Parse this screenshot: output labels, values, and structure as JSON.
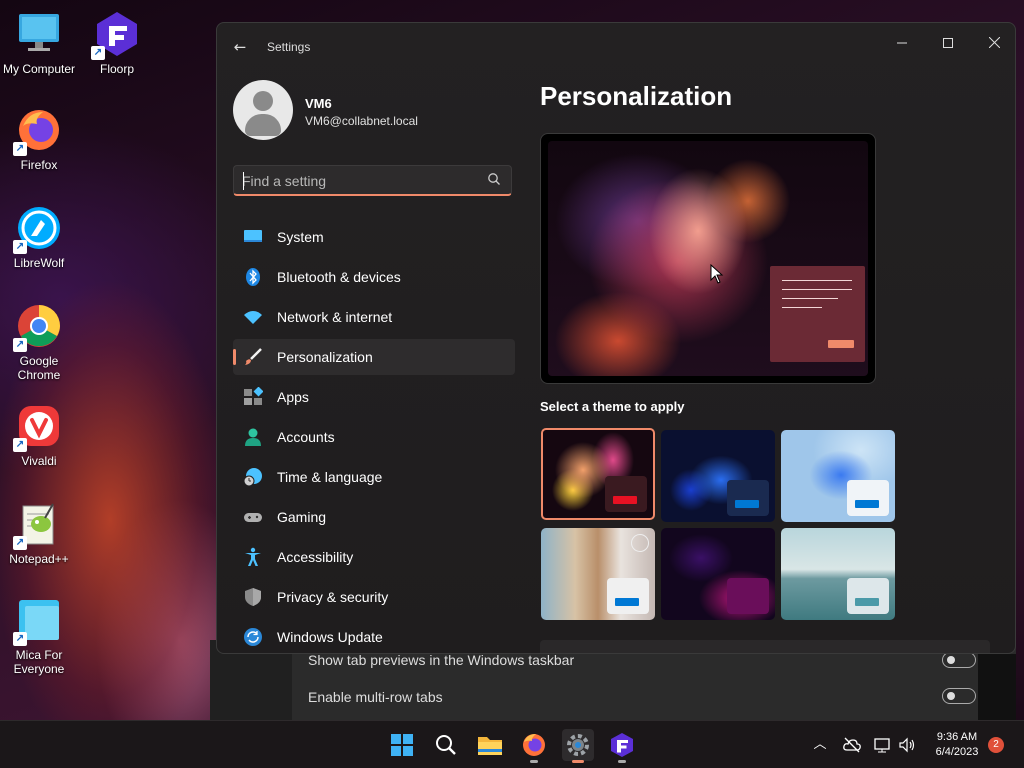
{
  "desktop": {
    "icons": [
      {
        "label": "My Computer",
        "icon": "computer-icon"
      },
      {
        "label": "Floorp",
        "icon": "floorp-icon"
      },
      {
        "label": "Firefox",
        "icon": "firefox-icon"
      },
      {
        "label": "LibreWolf",
        "icon": "librewolf-icon"
      },
      {
        "label": "Google Chrome",
        "icon": "chrome-icon"
      },
      {
        "label": "Vivaldi",
        "icon": "vivaldi-icon"
      },
      {
        "label": "Notepad++",
        "icon": "notepadpp-icon"
      },
      {
        "label": "Mica For Everyone",
        "icon": "mica-icon"
      }
    ]
  },
  "background_app": {
    "rows": [
      {
        "label": "Show tab previews in the Windows taskbar"
      },
      {
        "label": "Enable multi-row tabs"
      }
    ]
  },
  "settings": {
    "title": "Settings",
    "user": {
      "name": "VM6",
      "email": "VM6@collabnet.local"
    },
    "search": {
      "placeholder": "Find a setting"
    },
    "nav": [
      {
        "label": "System",
        "icon": "system-icon"
      },
      {
        "label": "Bluetooth & devices",
        "icon": "bluetooth-icon"
      },
      {
        "label": "Network & internet",
        "icon": "wifi-icon"
      },
      {
        "label": "Personalization",
        "icon": "brush-icon",
        "active": true
      },
      {
        "label": "Apps",
        "icon": "apps-icon"
      },
      {
        "label": "Accounts",
        "icon": "accounts-icon"
      },
      {
        "label": "Time & language",
        "icon": "clock-globe-icon"
      },
      {
        "label": "Gaming",
        "icon": "gamepad-icon"
      },
      {
        "label": "Accessibility",
        "icon": "accessibility-icon"
      },
      {
        "label": "Privacy & security",
        "icon": "shield-icon"
      },
      {
        "label": "Windows Update",
        "icon": "update-icon"
      }
    ],
    "main": {
      "title": "Personalization",
      "theme_heading": "Select a theme to apply"
    },
    "colors": {
      "accent": "#f08a6a"
    }
  },
  "taskbar": {
    "time": "9:36 AM",
    "date": "6/4/2023",
    "notifications": "2"
  }
}
